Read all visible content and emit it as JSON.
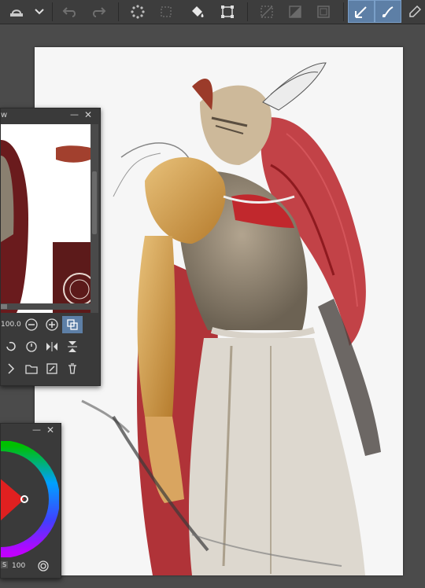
{
  "navigator": {
    "title_fragment": "w",
    "zoom_value": "100.0"
  },
  "color_wheel": {
    "value_label": "100",
    "color_s_label": "S"
  },
  "colors": {
    "toolbar_bg": "#3d3d3d",
    "panel_bg": "#3a3a3a",
    "active_tool": "#5d7fa6",
    "hair_red": "#b82228",
    "canvas_bg": "#f6f6f6"
  },
  "icons": {
    "toolbar": [
      "fill-tool-icon",
      "dropdown-chevron-icon",
      "undo-icon",
      "redo-icon",
      "loading-spinner-icon",
      "transform-icon",
      "fill-bucket-icon",
      "selection-transform-icon",
      "clear-selection-icon",
      "invert-selection-icon",
      "stroke-selection-icon",
      "vector-pen-icon",
      "brush-curve-icon",
      "edit-icon"
    ],
    "navigator": [
      "zoom-out-icon",
      "zoom-in-icon",
      "fit-view-icon",
      "rotate-left-icon",
      "reset-rotation-icon",
      "flip-horizontal-icon",
      "flip-vertical-icon",
      "play-icon",
      "open-folder-icon",
      "new-view-icon",
      "delete-icon"
    ]
  }
}
